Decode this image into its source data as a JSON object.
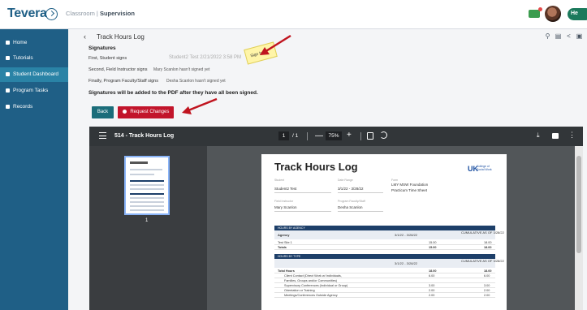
{
  "app": {
    "logo_text": "Tevera",
    "breadcrumb_prefix": "Classroom |",
    "breadcrumb_current": "Supervision",
    "help_label": "He"
  },
  "sidebar": {
    "items": [
      {
        "label": "Home",
        "icon": "grid-icon"
      },
      {
        "label": "Tutorials",
        "icon": "video-icon"
      },
      {
        "label": "Student Dashboard",
        "icon": "person-icon"
      },
      {
        "label": "Program Tasks",
        "icon": "tasks-icon"
      },
      {
        "label": "Records",
        "icon": "folder-icon"
      }
    ],
    "active_index": 2
  },
  "page": {
    "back_symbol": "‹",
    "title": "Track Hours Log"
  },
  "signatures": {
    "heading": "Signatures",
    "rows": [
      {
        "label": "First, Student signs",
        "value": ""
      },
      {
        "label": "Second, Field Instructor signs",
        "value": "Mary Scanlon hasn't signed yet"
      },
      {
        "label": "Finally, Program Faculty/Staff signs",
        "value": "Desha Scanlon hasn't signed yet"
      }
    ],
    "student_signature": "Student2 Test    2/21/2022 3:58 PM",
    "sign_here_note": "Sign here",
    "footer_note": "Signatures will be added to the PDF after they have all been signed."
  },
  "buttons": {
    "back": "Back",
    "request_changes": "Request Changes"
  },
  "pdf": {
    "filename": "514 - Track Hours Log",
    "page_current": "1",
    "page_total": "/ 1",
    "zoom": "75%",
    "minus": "—",
    "plus": "+",
    "thumbnail_page_number": "1",
    "document": {
      "title": "Track Hours Log",
      "logo_uk": "UK",
      "logo_college": "College of\nSocial Work",
      "student_label": "Student",
      "student_value": "Student2 Test",
      "date_range_label": "Date Range",
      "date_range_value": "3/1/22 - 3/28/22",
      "form_label": "Form",
      "form_value_1": "LMY MSW Foundation",
      "form_value_2": "Practicum Time Sheet",
      "field_instructor_label": "Field Instructor",
      "field_instructor_value": "Mary Scanlon",
      "faculty_label": "Program Faculty/Staff",
      "faculty_value": "Desha Scanlon",
      "agency_table": {
        "header": "HOURS BY AGENCY",
        "col1": "Agency",
        "col2": "3/1/22 - 3/28/22",
        "col3": "CUMULATIVE AS OF 3/28/22",
        "rows": [
          {
            "name": "Test Site 1",
            "period": "15.00",
            "cumulative": "18.00"
          },
          {
            "name": "Totals",
            "period": "15.00",
            "cumulative": "18.00"
          }
        ]
      },
      "type_table": {
        "header": "HOURS BY TYPE",
        "col2": "3/1/22 - 3/28/22",
        "col3": "CUMULATIVE AS OF 3/28/22",
        "rows": [
          {
            "name": "Total Hours",
            "period": "18.00",
            "cumulative": "18.00"
          },
          {
            "name": "Client Contact (Direct Work w/ Individuals,",
            "period": "6.00",
            "cumulative": "6.00"
          },
          {
            "name": "Families, Groups and/or Communities)",
            "period": "",
            "cumulative": ""
          },
          {
            "name": "Supervisory Conferences (Individual or Group)",
            "period": "3.00",
            "cumulative": "3.00"
          },
          {
            "name": "Orientation or Training",
            "period": "2.00",
            "cumulative": "2.00"
          },
          {
            "name": "Meetings/Conferences Outside Agency",
            "period": "2.00",
            "cumulative": "2.00"
          }
        ]
      }
    }
  },
  "colors": {
    "brand_blue": "#1f5f86",
    "sidebar_active": "#2a83a6",
    "back_button": "#1b6d7a",
    "request_button": "#c2152b",
    "annotation_arrow": "#c0141f",
    "sticky_note": "#fff5a8"
  }
}
